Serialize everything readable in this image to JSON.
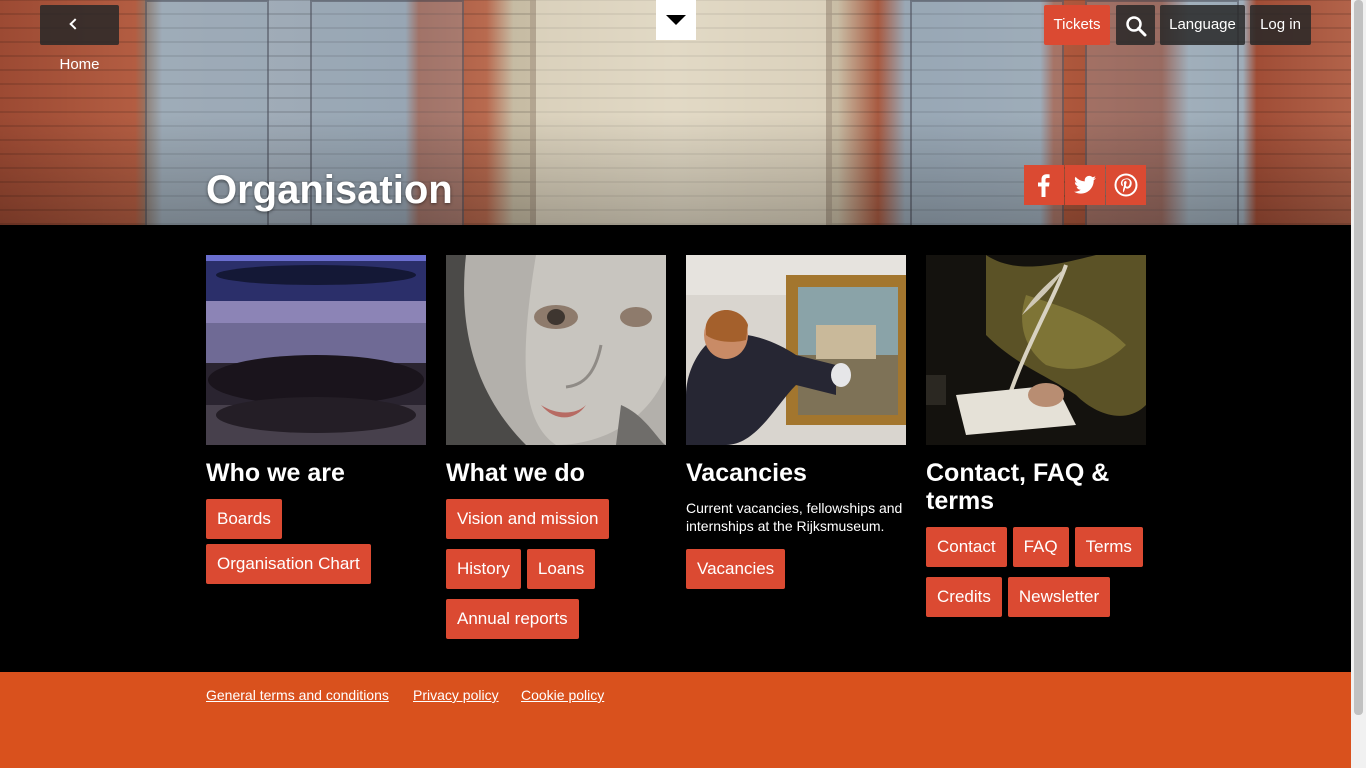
{
  "header": {
    "home_label": "Home",
    "tickets_label": "Tickets",
    "language_label": "Language",
    "login_label": "Log in",
    "page_title": "Organisation"
  },
  "sections": [
    {
      "title": "Who we are",
      "description": "",
      "links": [
        "Boards",
        "Organisation Chart"
      ]
    },
    {
      "title": "What we do",
      "description": "",
      "links": [
        "Vision and mission",
        "History",
        "Loans",
        "Annual reports"
      ]
    },
    {
      "title": "Vacancies",
      "description": "Current vacancies, fellowships and internships at the Rijksmuseum.",
      "links": [
        "Vacancies"
      ]
    },
    {
      "title": "Contact, FAQ & terms",
      "description": "",
      "links": [
        "Contact",
        "FAQ",
        "Terms",
        "Credits",
        "Newsletter"
      ]
    }
  ],
  "footer": {
    "links": [
      "General terms and conditions",
      "Privacy policy",
      "Cookie policy"
    ]
  },
  "colors": {
    "accent": "#db4a32",
    "footer": "#d9511d",
    "background": "#000000"
  },
  "icons": [
    "chevron-left-icon",
    "caret-down-icon",
    "search-icon",
    "facebook-icon",
    "twitter-icon",
    "pinterest-icon"
  ]
}
